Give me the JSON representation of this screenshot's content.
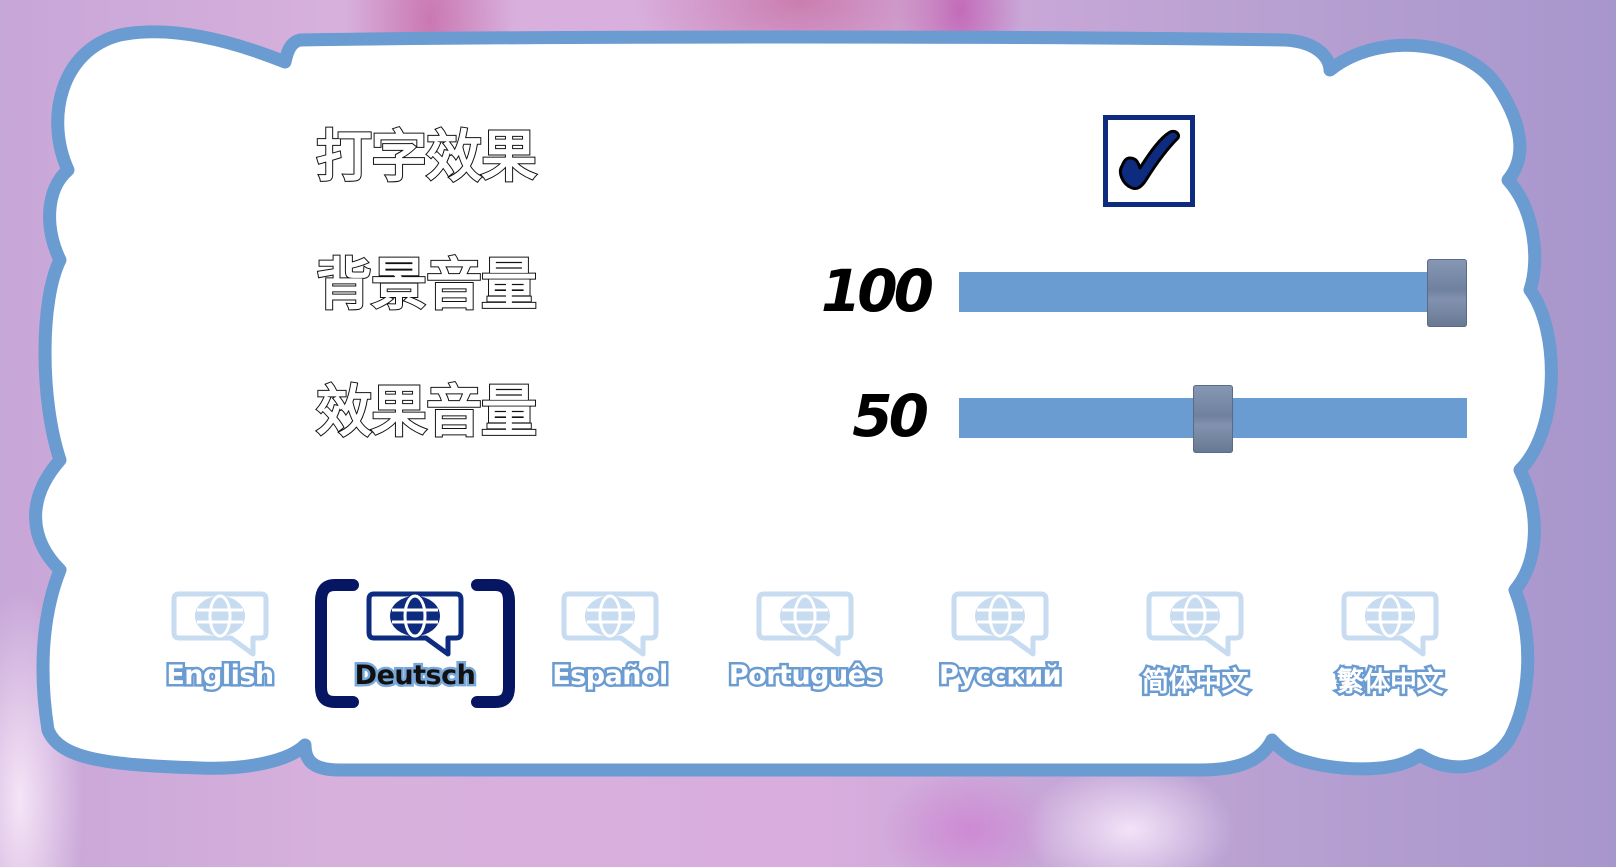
{
  "settings": {
    "typing_effect": {
      "label": "打字效果",
      "checked": true
    },
    "bgm_volume": {
      "label": "背景音量",
      "value": 100,
      "display": "100",
      "min": 0,
      "max": 100
    },
    "sfx_volume": {
      "label": "效果音量",
      "value": 50,
      "display": "50",
      "min": 0,
      "max": 100
    }
  },
  "languages": {
    "selected": "Deutsch",
    "items": [
      {
        "label": "English",
        "icon": "globe-speech-bubble-icon"
      },
      {
        "label": "Deutsch",
        "icon": "globe-speech-bubble-icon"
      },
      {
        "label": "Español",
        "icon": "globe-speech-bubble-icon"
      },
      {
        "label": "Português",
        "icon": "globe-speech-bubble-icon"
      },
      {
        "label": "Русский",
        "icon": "globe-speech-bubble-icon"
      },
      {
        "label": "简体中文",
        "icon": "globe-speech-bubble-icon"
      },
      {
        "label": "繁体中文",
        "icon": "globe-speech-bubble-icon"
      }
    ]
  },
  "colors": {
    "frame_border": "#6a9bd1",
    "accent_dark": "#0d2b7f",
    "icon_inactive": "#c7dbf1",
    "slider_track": "#6a9bd1"
  }
}
